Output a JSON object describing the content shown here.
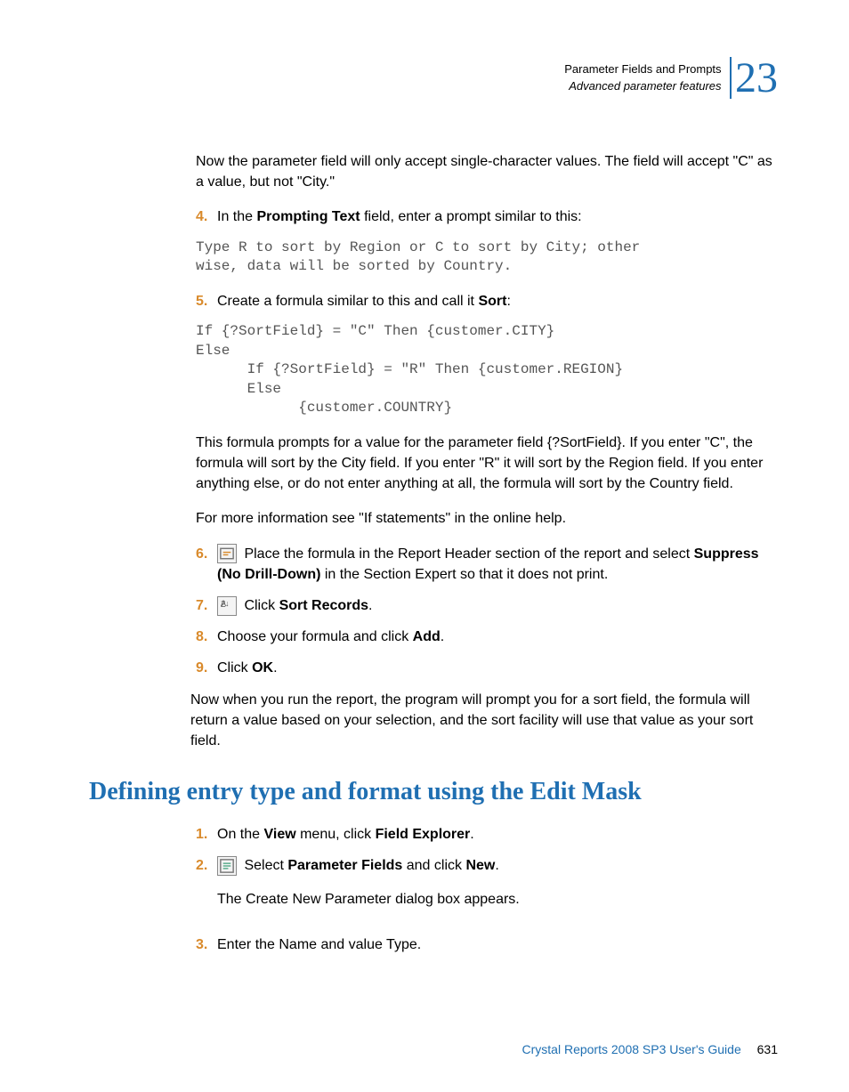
{
  "header": {
    "line1": "Parameter Fields and Prompts",
    "line2": "Advanced parameter features",
    "chapter": "23"
  },
  "intro_para": "Now the parameter field will only accept single-character values. The field will accept \"C\" as a value, but not \"City.\"",
  "steps_a": [
    {
      "num": "4.",
      "pre": "In the ",
      "bold1": "Prompting Text",
      "post": " field, enter a prompt similar to this:"
    }
  ],
  "code1": "Type R to sort by Region or C to sort by City; other\nwise, data will be sorted by Country.",
  "step5": {
    "num": "5.",
    "pre": "Create a formula similar to this and call it ",
    "bold": "Sort",
    "post": ":"
  },
  "code2": "If {?SortField} = \"C\" Then {customer.CITY}\nElse\n      If {?SortField} = \"R\" Then {customer.REGION}\n      Else\n            {customer.COUNTRY}",
  "para_after_code2_a": "This formula prompts for a value for the parameter field {?SortField}. If you enter \"C\", the formula will sort by the City field. If you enter \"R\" it will sort by the Region field. If you enter anything else, or do not enter anything at all, the formula will sort by the Country field.",
  "para_after_code2_b": "For more information see \"If statements\" in the online help.",
  "step6": {
    "num": "6.",
    "text_pre": " Place the formula in the Report Header section of the report and select ",
    "bold": "Suppress (No Drill-Down)",
    "text_post": " in the Section Expert so that it does not print."
  },
  "step7": {
    "num": "7.",
    "pre": " Click ",
    "bold": "Sort Records",
    "post": "."
  },
  "step8": {
    "num": "8.",
    "pre": "Choose your formula and click ",
    "bold": "Add",
    "post": "."
  },
  "step9": {
    "num": "9.",
    "pre": "Click ",
    "bold": "OK",
    "post": "."
  },
  "closing_para": "Now when you run the report, the program will prompt you for a sort field, the formula will return a value based on your selection, and the sort facility will use that value as your sort field.",
  "section_heading": "Defining entry type and format using the Edit Mask",
  "b_step1": {
    "num": "1.",
    "pre": "On the ",
    "bold1": "View",
    "mid": " menu, click ",
    "bold2": "Field Explorer",
    "post": "."
  },
  "b_step2": {
    "num": "2.",
    "pre": " Select ",
    "bold1": "Parameter Fields",
    "mid": " and click ",
    "bold2": "New",
    "post": "."
  },
  "b_step2_sub": "The Create New Parameter dialog box appears.",
  "b_step3": {
    "num": "3.",
    "text": "Enter the Name and value Type."
  },
  "footer": {
    "title": "Crystal Reports 2008 SP3 User's Guide",
    "page": "631"
  }
}
